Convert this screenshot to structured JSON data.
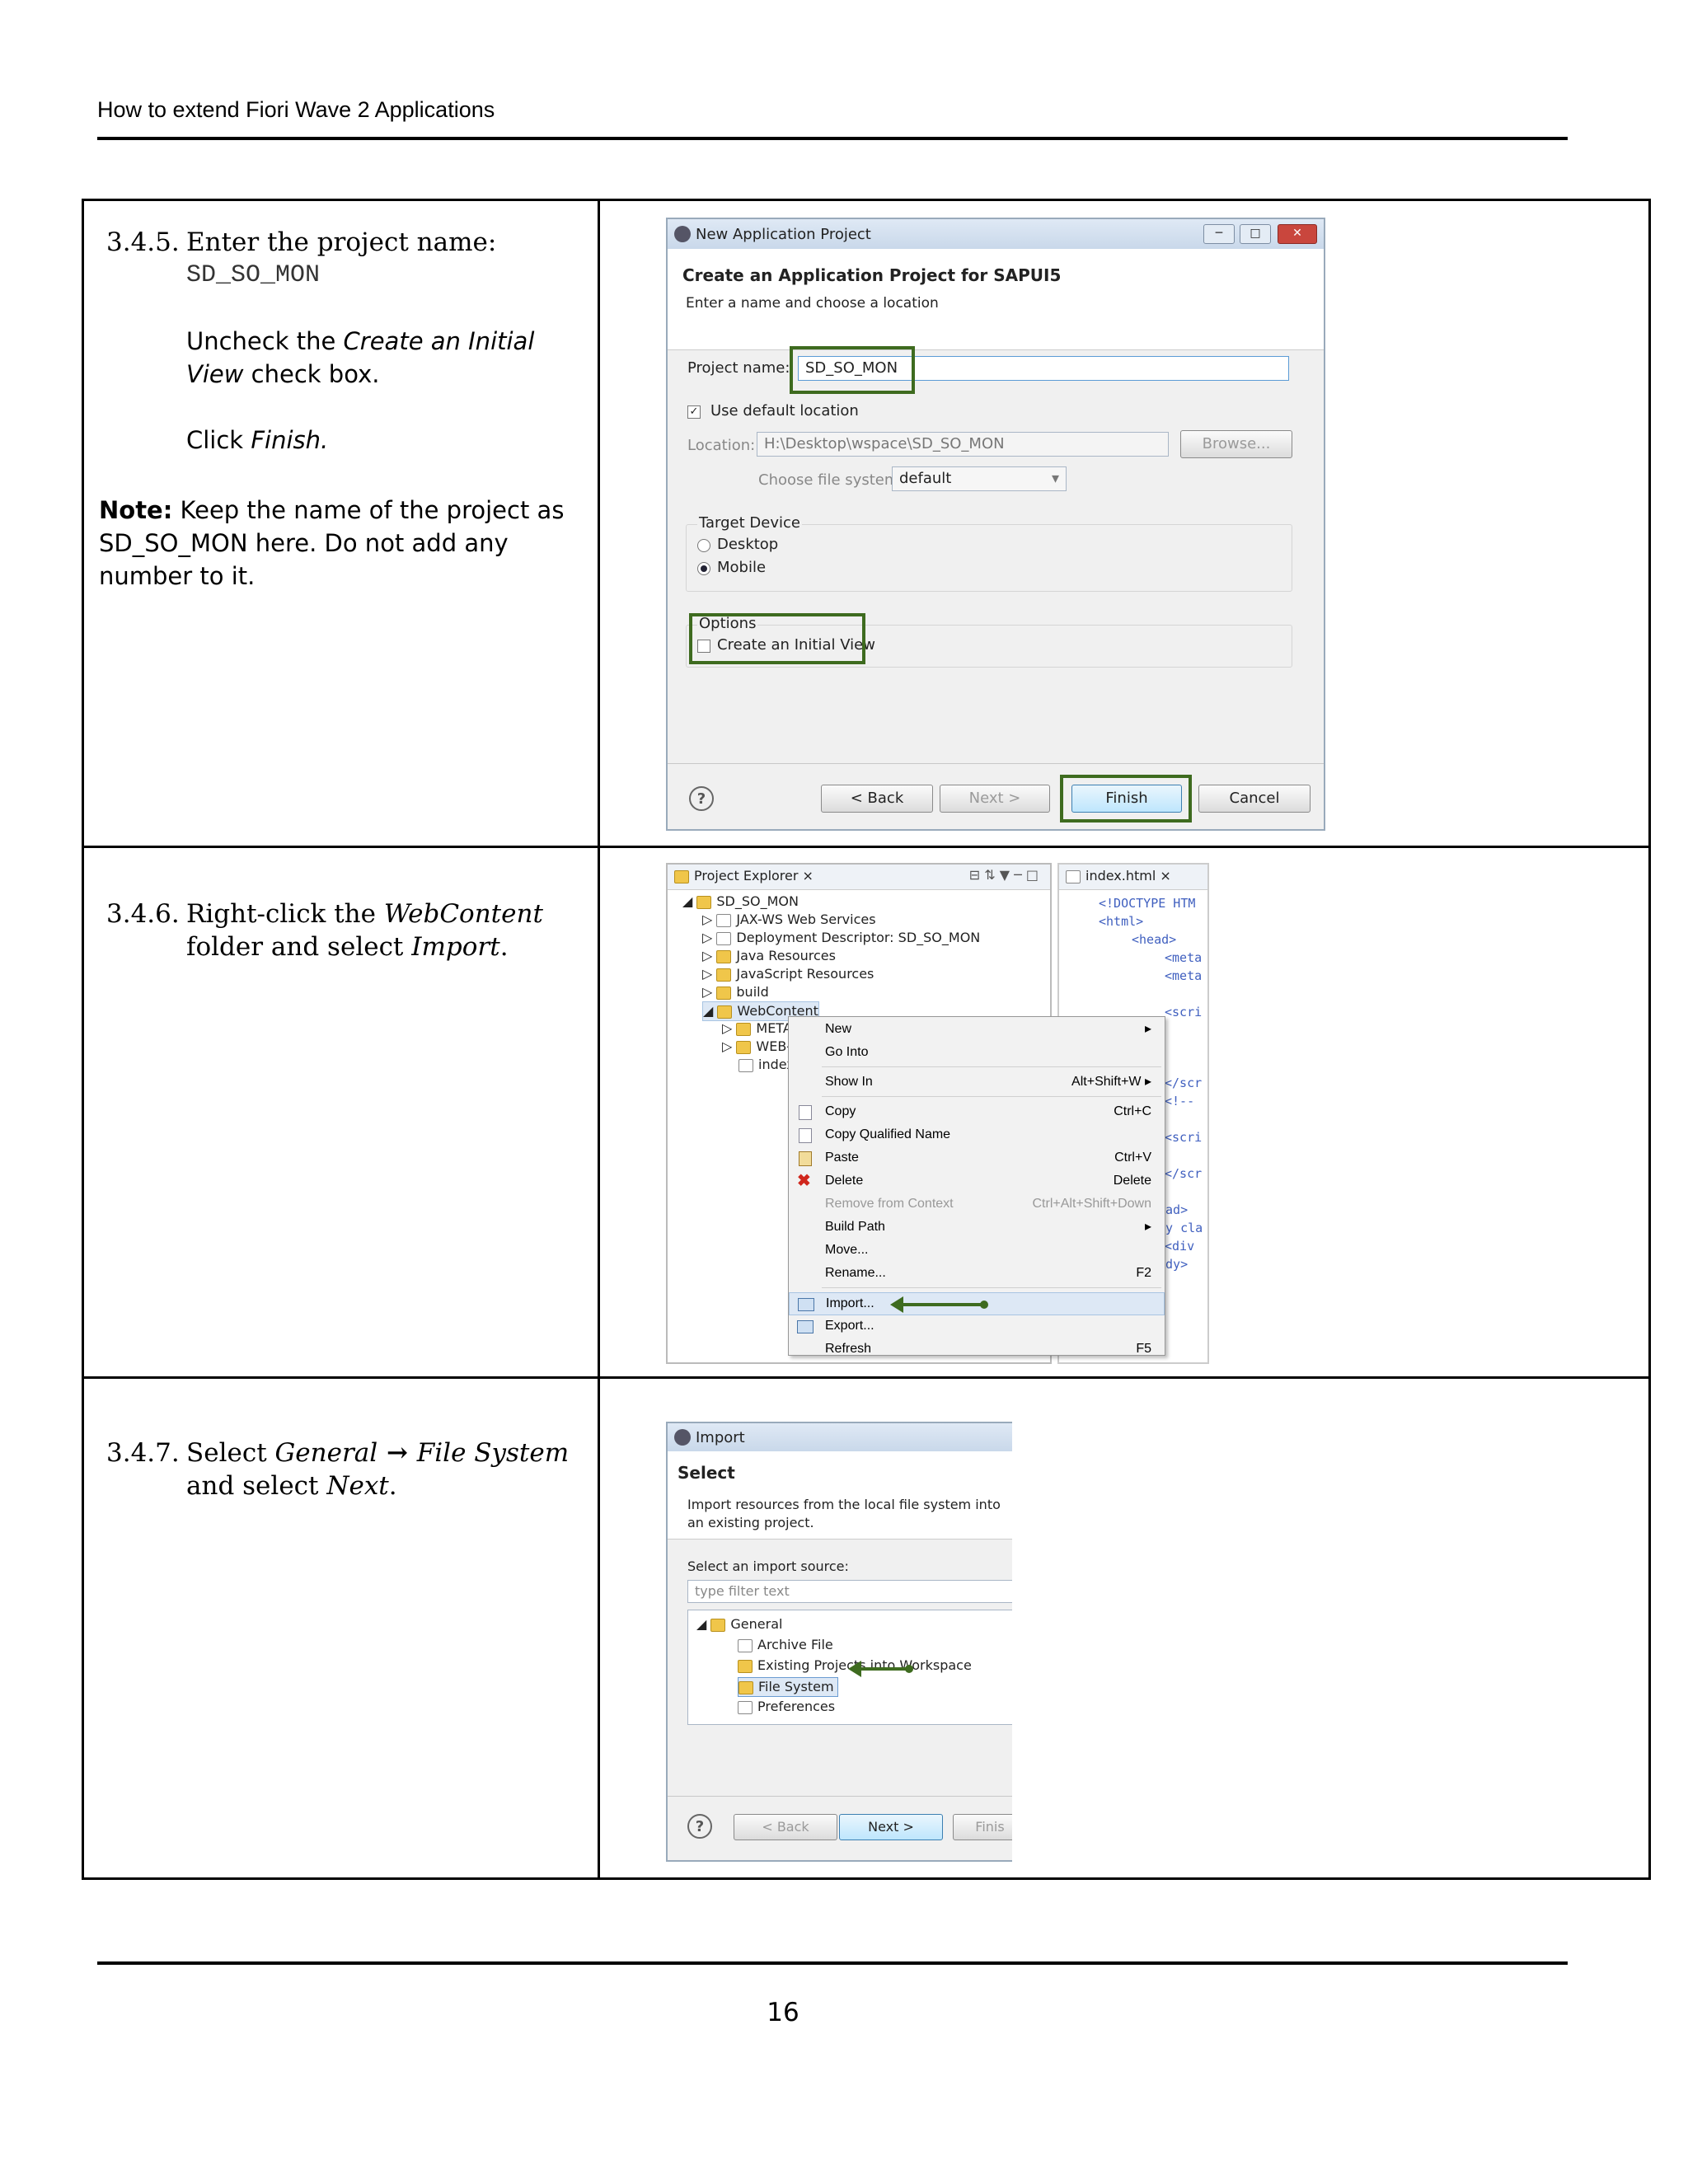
{
  "header": {
    "title": "How to extend Fiori Wave 2 Applications"
  },
  "footer": {
    "page_number": "16"
  },
  "steps": [
    {
      "number": "3.4.5.",
      "line1": "Enter the project name:",
      "project_name": "SD_SO_MON",
      "uncheck_pre": "Uncheck the ",
      "uncheck_em": "Create an Initial View",
      "uncheck_post": " check box.",
      "click_pre": "Click ",
      "click_em": "Finish.",
      "note_label": "Note:",
      "note_text": " Keep the name of the project as SD_SO_MON here. Do not add any number to it."
    },
    {
      "number": "3.4.6.",
      "pre": "Right-click the ",
      "em1": "WebContent",
      "mid": " folder and select ",
      "em2": "Import",
      "post": "."
    },
    {
      "number": "3.4.7.",
      "pre": "Select ",
      "em1": "General",
      "arrow": " → ",
      "em2": "File System",
      "mid": " and select ",
      "em3": "Next",
      "post": "."
    }
  ],
  "shot1": {
    "window_title": "New Application Project",
    "banner_title": "Create an Application Project for SAPUI5",
    "banner_sub": "Enter a name and choose a location",
    "project_label": "Project name:",
    "project_value": "SD_SO_MON",
    "default_loc": "Use default location",
    "location_label": "Location:",
    "location_value": "H:\\Desktop\\wspace\\SD_SO_MON",
    "browse": "Browse...",
    "fs_label": "Choose file system:",
    "fs_value": "default",
    "target_label": "Target Device",
    "desktop": "Desktop",
    "mobile": "Mobile",
    "options_label": "Options",
    "initial_view": "Create an Initial View",
    "back": "< Back",
    "next": "Next >",
    "finish": "Finish",
    "cancel": "Cancel"
  },
  "shot2": {
    "explorer_tab": "Project Explorer",
    "editor_tab": "index.html",
    "tree": [
      "SD_SO_MON",
      "JAX-WS Web Services",
      "Deployment Descriptor: SD_SO_MON",
      "Java Resources",
      "JavaScript Resources",
      "build",
      "WebContent",
      "META",
      "WEB-",
      "index"
    ],
    "code": [
      "<!DOCTYPE HTM",
      "<html>",
      "<head>",
      "<meta",
      "<meta",
      "<scri",
      "</scr",
      "<!--",
      "<scri",
      "</scr",
      "ead>",
      "dy cla",
      "<div",
      "ody>"
    ],
    "menu": [
      {
        "label": "New",
        "shortcut": "▸"
      },
      {
        "label": "Go Into",
        "shortcut": ""
      },
      {
        "label": "Show In",
        "shortcut": "Alt+Shift+W ▸"
      },
      {
        "label": "Copy",
        "shortcut": "Ctrl+C"
      },
      {
        "label": "Copy Qualified Name",
        "shortcut": ""
      },
      {
        "label": "Paste",
        "shortcut": "Ctrl+V"
      },
      {
        "label": "Delete",
        "shortcut": "Delete"
      },
      {
        "label": "Remove from Context",
        "shortcut": "Ctrl+Alt+Shift+Down"
      },
      {
        "label": "Build Path",
        "shortcut": "▸"
      },
      {
        "label": "Move...",
        "shortcut": ""
      },
      {
        "label": "Rename...",
        "shortcut": "F2"
      },
      {
        "label": "Import...",
        "shortcut": ""
      },
      {
        "label": "Export...",
        "shortcut": ""
      },
      {
        "label": "Refresh",
        "shortcut": "F5"
      }
    ]
  },
  "shot3": {
    "window_title": "Import",
    "banner_title": "Select",
    "banner_sub": "Import resources from the local file system into an existing project.",
    "source_label": "Select an import source:",
    "filter_placeholder": "type filter text",
    "tree": [
      "General",
      "Archive File",
      "Existing Projects into Workspace",
      "File System",
      "Preferences"
    ],
    "back": "< Back",
    "next": "Next >",
    "finish": "Finis"
  }
}
